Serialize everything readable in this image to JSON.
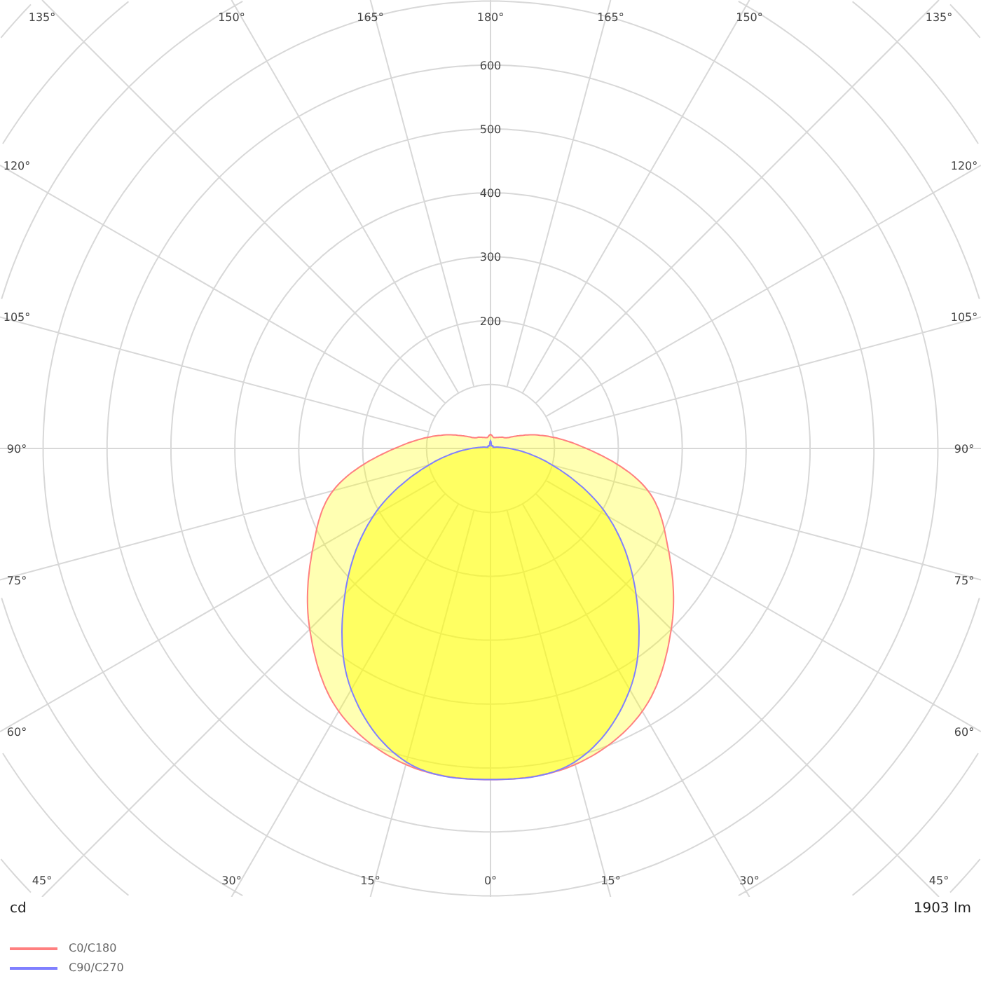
{
  "chart": {
    "radial_labels": [
      "600",
      "500",
      "400",
      "300",
      "200"
    ],
    "angle_labels": [
      "135°",
      "150°",
      "165°",
      "180°",
      "165°",
      "150°",
      "135°",
      "120°",
      "120°",
      "105°",
      "105°",
      "90°",
      "90°",
      "75°",
      "75°",
      "60°",
      "60°",
      "45°",
      "30°",
      "15°",
      "0°",
      "15°",
      "30°",
      "45°"
    ]
  },
  "unit_label": "cd",
  "flux_label": "1903 lm",
  "legend": [
    {
      "label": "C0/C180",
      "color": "#ff8080"
    },
    {
      "label": "C90/C270",
      "color": "#8080ff"
    }
  ]
}
